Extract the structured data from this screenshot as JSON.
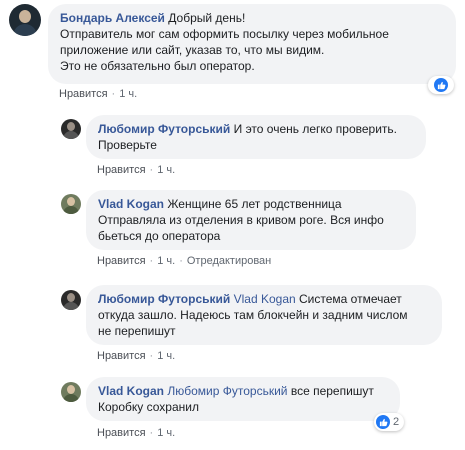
{
  "comments": [
    {
      "author": "Бондарь Алексей",
      "text_line1": "Добрый день!",
      "text_line2": "Отправитель мог сам оформить посылку через мобильное",
      "text_line3": "приложение или сайт, указав то, что мы видим.",
      "text_line4": "Это не обязательно был оператор.",
      "like_label": "Нравится",
      "time": "1 ч.",
      "reaction_icon": "like-icon",
      "reaction_count": ""
    },
    {
      "author": "Любомир Футорський",
      "text_line1": "И это очень легко проверить.",
      "text_line2": "Проверьте",
      "like_label": "Нравится",
      "time": "1 ч."
    },
    {
      "author": "Vlad Kogan",
      "text_line1": "Женщине 65 лет родственница",
      "text_line2": "Отправляла из отделения в кривом роге. Вся инфо",
      "text_line3": "бьеться до оператора",
      "like_label": "Нравится",
      "time": "1 ч.",
      "edited_label": "Отредактирован"
    },
    {
      "author": "Любомир Футорський",
      "mention": "Vlad Kogan",
      "text_line1": "Система отмечает",
      "text_line2": "откуда зашло. Надеюсь там блокчейн и задним числом",
      "text_line3": "не перепишут",
      "like_label": "Нравится",
      "time": "1 ч."
    },
    {
      "author": "Vlad Kogan",
      "mention": "Любомир Футорський",
      "text_line1": "все перепишут",
      "text_line2": "Коробку сохранил",
      "like_label": "Нравится",
      "time": "1 ч.",
      "reaction_icon": "like-icon",
      "reaction_count": "2"
    }
  ],
  "colors": {
    "author": "#385898",
    "bubble": "#f2f3f5",
    "like_blue": "#2078f4"
  }
}
